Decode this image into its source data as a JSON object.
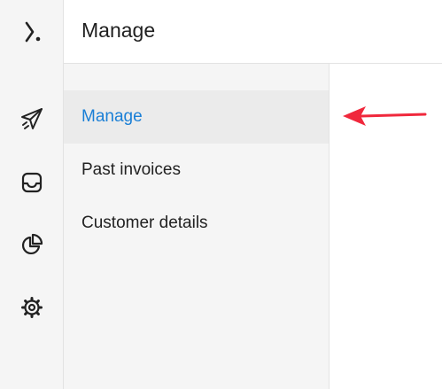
{
  "header": {
    "title": "Manage"
  },
  "rail": {
    "icons": [
      "logo-icon",
      "send-icon",
      "inbox-icon",
      "pie-chart-icon",
      "gear-icon"
    ]
  },
  "subnav": {
    "items": [
      {
        "label": "Manage",
        "active": true
      },
      {
        "label": "Past invoices",
        "active": false
      },
      {
        "label": "Customer details",
        "active": false
      }
    ]
  },
  "colors": {
    "accent": "#1a7fd6",
    "annotation_arrow": "#f0283c",
    "sidebar_bg": "#f5f5f5",
    "active_bg": "#ebebeb"
  }
}
